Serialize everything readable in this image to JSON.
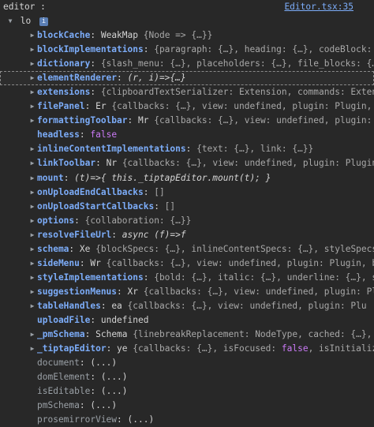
{
  "header": {
    "title": "editor :",
    "source_link": "Editor.tsx:35"
  },
  "root": {
    "name": "lo",
    "badge": "i"
  },
  "properties": [
    {
      "key": "blockCache",
      "expandable": true,
      "type": "WeakMap",
      "preview": "{Node => {…}}"
    },
    {
      "key": "blockImplementations",
      "expandable": true,
      "type": "",
      "preview": "{paragraph: {…}, heading: {…}, codeBlock: {…"
    },
    {
      "key": "dictionary",
      "expandable": true,
      "type": "",
      "preview": "{slash_menu: {…}, placeholders: {…}, file_blocks: {…"
    },
    {
      "key": "elementRenderer",
      "expandable": true,
      "type": "",
      "preview": "(r, i)=>{…}",
      "highlighted": true,
      "italic": true
    },
    {
      "key": "extensions",
      "expandable": true,
      "type": "",
      "preview": "{clipboardTextSerializer: Extension, commands: Exten"
    },
    {
      "key": "filePanel",
      "expandable": true,
      "type": "Er",
      "preview": "{callbacks: {…}, view: undefined, plugin: Plugin, v"
    },
    {
      "key": "formattingToolbar",
      "expandable": true,
      "type": "Mr",
      "preview": "{callbacks: {…}, view: undefined, plugin: Plugin,"
    },
    {
      "key": "headless",
      "expandable": false,
      "type": "",
      "preview": "false",
      "bool": true
    },
    {
      "key": "inlineContentImplementations",
      "expandable": true,
      "type": "",
      "preview": "{text: {…}, link: {…}}"
    },
    {
      "key": "linkToolbar",
      "expandable": true,
      "type": "Nr",
      "preview": "{callbacks: {…}, view: undefined, plugin: Plugin"
    },
    {
      "key": "mount",
      "expandable": true,
      "type": "",
      "preview": "(t)=>{ this._tiptapEditor.mount(t); }",
      "italic": true
    },
    {
      "key": "onUploadEndCallbacks",
      "expandable": true,
      "type": "",
      "preview": "[]"
    },
    {
      "key": "onUploadStartCallbacks",
      "expandable": true,
      "type": "",
      "preview": "[]"
    },
    {
      "key": "options",
      "expandable": true,
      "type": "",
      "preview": "{collaboration: {…}}"
    },
    {
      "key": "resolveFileUrl",
      "expandable": true,
      "type": "",
      "preview": "async (f)=>f",
      "italic": true
    },
    {
      "key": "schema",
      "expandable": true,
      "type": "Xe",
      "preview": "{blockSpecs: {…}, inlineContentSpecs: {…}, styleSpecs"
    },
    {
      "key": "sideMenu",
      "expandable": true,
      "type": "Wr",
      "preview": "{callbacks: {…}, view: undefined, plugin: Plugin, b"
    },
    {
      "key": "styleImplementations",
      "expandable": true,
      "type": "",
      "preview": "{bold: {…}, italic: {…}, underline: {…}, s"
    },
    {
      "key": "suggestionMenus",
      "expandable": true,
      "type": "Xr",
      "preview": "{callbacks: {…}, view: undefined, plugin: Pl"
    },
    {
      "key": "tableHandles",
      "expandable": true,
      "type": "ea",
      "preview": "{callbacks: {…}, view: undefined, plugin: Plu"
    },
    {
      "key": "uploadFile",
      "expandable": false,
      "type": "",
      "preview": "undefined"
    },
    {
      "key": "_pmSchema",
      "expandable": true,
      "type": "Schema",
      "preview": "{linebreakReplacement: NodeType, cached: {…},"
    },
    {
      "key": "_tiptapEditor",
      "expandable": true,
      "type": "ye",
      "preview_parts": [
        "{callbacks: {…}, isFocused: ",
        "false",
        ", isInitializ"
      ]
    }
  ],
  "getters": [
    {
      "key": "document",
      "value": "(...)"
    },
    {
      "key": "domElement",
      "value": "(...)"
    },
    {
      "key": "isEditable",
      "value": "(...)"
    },
    {
      "key": "pmSchema",
      "value": "(...)"
    },
    {
      "key": "prosemirrorView",
      "value": "(...)"
    }
  ],
  "colors": {
    "background": "#282828",
    "key": "#7cacf8",
    "link": "#7cacf8",
    "boolean": "#cb7af7",
    "muted": "#a8a8a8"
  }
}
